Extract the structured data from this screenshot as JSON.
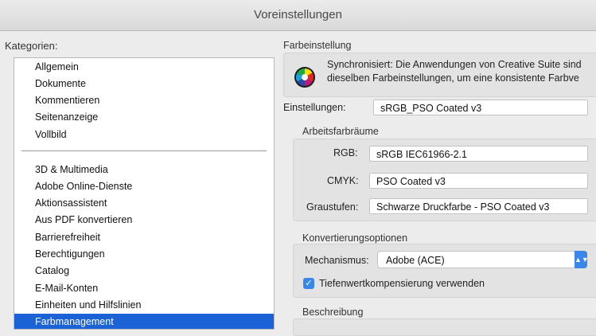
{
  "window": {
    "title": "Voreinstellungen"
  },
  "categories": {
    "label": "Kategorien:",
    "group1": [
      "Allgemein",
      "Dokumente",
      "Kommentieren",
      "Seitenanzeige",
      "Vollbild"
    ],
    "group2": [
      "3D & Multimedia",
      "Adobe Online-Dienste",
      "Aktionsassistent",
      "Aus PDF konvertieren",
      "Barrierefreiheit",
      "Berechtigungen",
      "Catalog",
      "E-Mail-Konten",
      "Einheiten und Hilfslinien",
      "Farbmanagement"
    ],
    "selected": "Farbmanagement"
  },
  "color_settings": {
    "section_title": "Farbeinstellung",
    "sync_line1": "Synchronisiert: Die Anwendungen von Creative Suite sind",
    "sync_line2": "dieselben Farbeinstellungen, um eine konsistente Farbve",
    "settings_label": "Einstellungen:",
    "settings_value": "sRGB_PSO Coated v3",
    "working_spaces": {
      "title": "Arbeitsfarbräume",
      "rgb_label": "RGB:",
      "rgb_value": "sRGB IEC61966-2.1",
      "cmyk_label": "CMYK:",
      "cmyk_value": "PSO Coated v3",
      "gray_label": "Graustufen:",
      "gray_value": "Schwarze Druckfarbe - PSO Coated v3"
    },
    "conversion": {
      "title": "Konvertierungsoptionen",
      "engine_label": "Mechanismus:",
      "engine_value": "Adobe (ACE)",
      "bpc_label": "Tiefenwertkompensierung verwenden",
      "bpc_checked": true
    },
    "description_title": "Beschreibung"
  },
  "colors": {
    "selection": "#1a62d6",
    "accent": "#3a86ea"
  },
  "icons": {
    "sync": "color-management-icon",
    "popup": "chevron-updown-icon",
    "check": "checkmark-icon"
  }
}
